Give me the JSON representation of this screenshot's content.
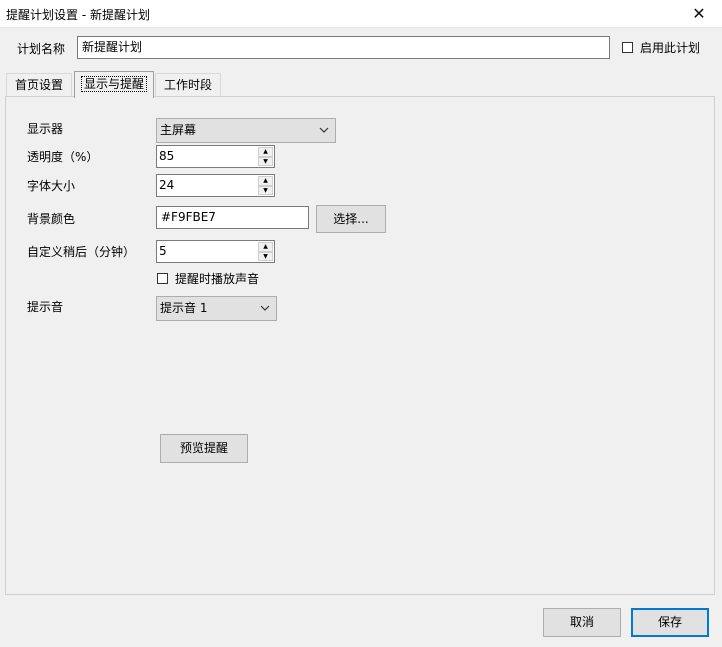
{
  "window": {
    "title": "提醒计划设置 - 新提醒计划",
    "close_glyph": "✕"
  },
  "plan": {
    "name_label": "计划名称",
    "name_value": "新提醒计划",
    "enable_label": "启用此计划",
    "enable_checked": false
  },
  "tabs": [
    {
      "label": "首页设置",
      "active": false
    },
    {
      "label": "显示与提醒",
      "active": true
    },
    {
      "label": "工作时段",
      "active": false
    }
  ],
  "display_settings": {
    "monitor_label": "显示器",
    "monitor_value": "主屏幕",
    "opacity_label": "透明度（%）",
    "opacity_value": "85",
    "font_size_label": "字体大小",
    "font_size_value": "24",
    "bg_color_label": "背景颜色",
    "bg_color_value": "#F9FBE7",
    "choose_button_label": "选择...",
    "snooze_label": "自定义稍后（分钟）",
    "snooze_value": "5",
    "play_sound_label": "提醒时播放声音",
    "play_sound_checked": false,
    "sound_label": "提示音",
    "sound_value": "提示音 1",
    "preview_button_label": "预览提醒"
  },
  "footer": {
    "cancel_label": "取消",
    "save_label": "保存"
  },
  "icons": {
    "dropdown": "chevron-down-icon",
    "spin_up": "spin-up-icon",
    "spin_down": "spin-down-icon",
    "close": "close-icon"
  },
  "colors": {
    "primary_border": "#0078d7",
    "window_bg": "#f0f0f0",
    "button_bg": "#e1e1e1"
  }
}
